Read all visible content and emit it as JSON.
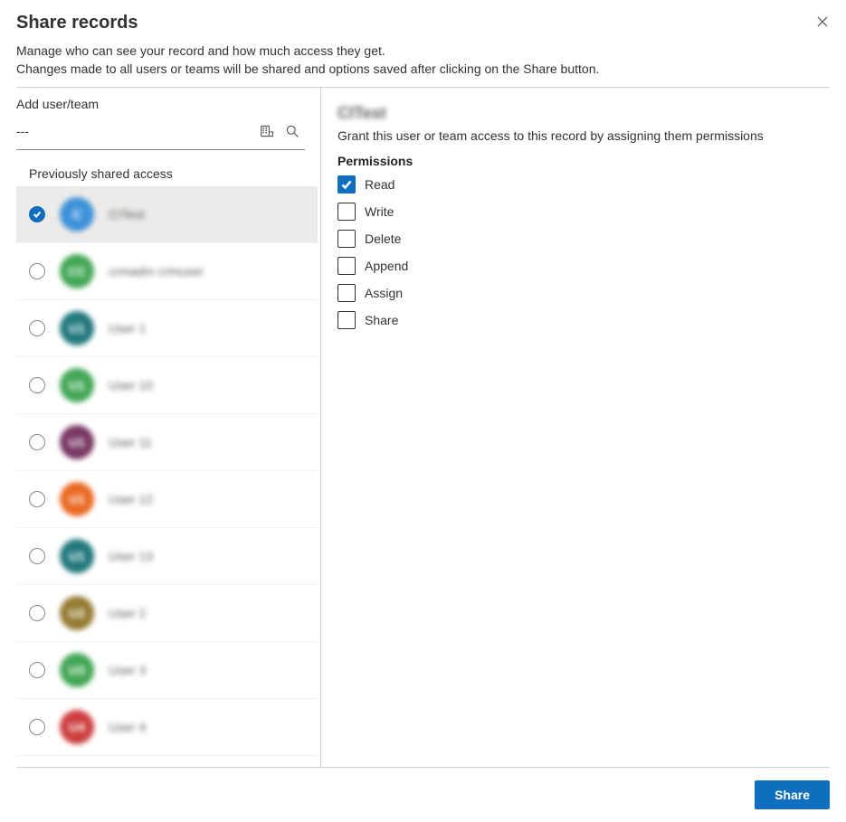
{
  "dialog": {
    "title": "Share records",
    "subtitle_line1": "Manage who can see your record and how much access they get.",
    "subtitle_line2": "Changes made to all users or teams will be shared and options saved after clicking on the Share button."
  },
  "left": {
    "add_label": "Add user/team",
    "search_value": "---",
    "section_title": "Previously shared access",
    "items": [
      {
        "name": "CITest",
        "avatar_bg": "#2b88d8",
        "avatar_text": "C",
        "selected": true
      },
      {
        "name": "crmadm crmuser",
        "avatar_bg": "#2f9e44",
        "avatar_text": "CC",
        "selected": false
      },
      {
        "name": "User 1",
        "avatar_bg": "#0b6b70",
        "avatar_text": "U1",
        "selected": false
      },
      {
        "name": "User 10",
        "avatar_bg": "#2f9e44",
        "avatar_text": "U1",
        "selected": false
      },
      {
        "name": "User 11",
        "avatar_bg": "#6b2252",
        "avatar_text": "U1",
        "selected": false
      },
      {
        "name": "User 12",
        "avatar_bg": "#e8590c",
        "avatar_text": "U1",
        "selected": false
      },
      {
        "name": "User 13",
        "avatar_bg": "#0b6b70",
        "avatar_text": "U1",
        "selected": false
      },
      {
        "name": "User 2",
        "avatar_bg": "#8a6d1d",
        "avatar_text": "U2",
        "selected": false
      },
      {
        "name": "User 3",
        "avatar_bg": "#2f9e44",
        "avatar_text": "U3",
        "selected": false
      },
      {
        "name": "User 4",
        "avatar_bg": "#c92a2a",
        "avatar_text": "U4",
        "selected": false
      }
    ]
  },
  "right": {
    "selected_name": "CITest",
    "grant_text": "Grant this user or team access to this record by assigning them permissions",
    "permissions_label": "Permissions",
    "permissions": [
      {
        "label": "Read",
        "checked": true
      },
      {
        "label": "Write",
        "checked": false
      },
      {
        "label": "Delete",
        "checked": false
      },
      {
        "label": "Append",
        "checked": false
      },
      {
        "label": "Assign",
        "checked": false
      },
      {
        "label": "Share",
        "checked": false
      }
    ]
  },
  "footer": {
    "share_button": "Share"
  }
}
